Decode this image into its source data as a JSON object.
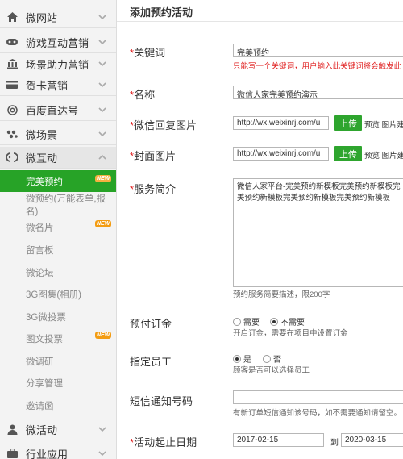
{
  "sidebar": {
    "menu": [
      {
        "label": "微网站",
        "icon": "home-icon"
      },
      {
        "label": "游戏互动营销",
        "icon": "gamepad-icon"
      },
      {
        "label": "场景助力营销",
        "icon": "building-icon"
      },
      {
        "label": "贺卡营销",
        "icon": "card-icon"
      },
      {
        "label": "百度直达号",
        "icon": "at-icon"
      },
      {
        "label": "微场景",
        "icon": "scenes-icon"
      },
      {
        "label": "微互动",
        "icon": "interact-icon"
      },
      {
        "label": "微活动",
        "icon": "person-icon"
      },
      {
        "label": "行业应用",
        "icon": "briefcase-icon"
      }
    ],
    "submenu": [
      {
        "label": "完美预约",
        "badge": "NEW"
      },
      {
        "label": "微预约(万能表单,报名)",
        "badge": ""
      },
      {
        "label": "微名片",
        "badge": "NEW"
      },
      {
        "label": "留言板",
        "badge": ""
      },
      {
        "label": "微论坛",
        "badge": ""
      },
      {
        "label": "3G图集(相册)",
        "badge": ""
      },
      {
        "label": "3G微投票",
        "badge": ""
      },
      {
        "label": "图文投票",
        "badge": "NEW"
      },
      {
        "label": "微调研",
        "badge": ""
      },
      {
        "label": "分享管理",
        "badge": ""
      },
      {
        "label": "邀请函",
        "badge": ""
      }
    ]
  },
  "main": {
    "title": "添加预约活动",
    "required_mark": "*",
    "keyword": {
      "label": "关键词",
      "value": "完美预约",
      "hint": "只能写一个关键词，用户输入此关键词将会触发此"
    },
    "name": {
      "label": "名称",
      "value": "微信人家完美预约演示"
    },
    "reply_image": {
      "label": "微信回复图片",
      "value": "http://wx.weixinrj.com/u",
      "upload": "上传",
      "extra": "预览 图片建"
    },
    "cover_image": {
      "label": "封面图片",
      "value": "http://wx.weixinrj.com/u",
      "upload": "上传",
      "extra": "预览 图片建"
    },
    "service_intro": {
      "label": "服务简介",
      "value": "微信人家平台-完美预约新模板完美预约新模板完美预约新模板完美预约新模板完美预约新模板",
      "hint": "预约服务简要描述，限200字"
    },
    "deposit": {
      "label": "预付订金",
      "options": [
        "需要",
        "不需要"
      ],
      "selected": "不需要",
      "hint": "开启订金，需要在项目中设置订金"
    },
    "staff": {
      "label": "指定员工",
      "options": [
        "是",
        "否"
      ],
      "selected": "是",
      "hint": "顾客是否可以选择员工"
    },
    "sms": {
      "label": "短信通知号码",
      "value": "",
      "hint": "有新订单短信通知该号码，如不需要通知请留空。"
    },
    "dates": {
      "label": "活动起止日期",
      "start": "2017-02-15",
      "separator": "到",
      "end": "2020-03-15"
    }
  },
  "colors": {
    "accent": "#27a327",
    "required": "#e02020",
    "sidebar_bg": "#f3f3f3"
  }
}
